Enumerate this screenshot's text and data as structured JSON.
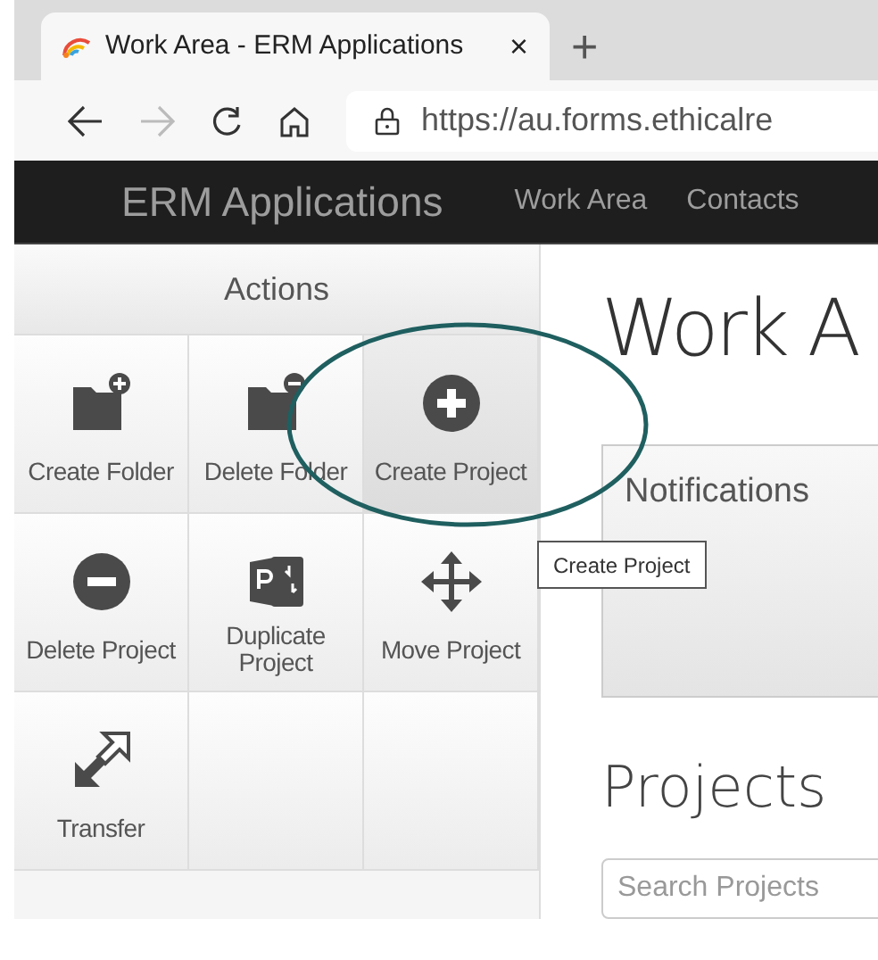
{
  "browser": {
    "tab": {
      "title": "Work Area - ERM Applications",
      "close": "×"
    },
    "new_tab": "+",
    "url": "https://au.forms.ethicalre"
  },
  "app_header": {
    "brand": "ERM Applications",
    "nav": [
      {
        "label": "Work Area",
        "selected": false
      },
      {
        "label": "Contacts",
        "selected": false
      }
    ]
  },
  "actions": {
    "title": "Actions",
    "items": [
      {
        "kind": "create-folder",
        "label": "Create Folder",
        "hovered": false
      },
      {
        "kind": "delete-folder",
        "label": "Delete Folder",
        "hovered": false
      },
      {
        "kind": "create-project",
        "label": "Create Project",
        "hovered": true
      },
      {
        "kind": "delete-project",
        "label": "Delete Project",
        "hovered": false
      },
      {
        "kind": "duplicate-project",
        "label": "Duplicate Project",
        "hovered": false
      },
      {
        "kind": "move-project",
        "label": "Move Project",
        "hovered": false
      },
      {
        "kind": "transfer",
        "label": "Transfer",
        "hovered": false
      }
    ]
  },
  "tooltip": "Create Project",
  "main": {
    "title": "Work A",
    "notifications": {
      "title": "Notifications"
    },
    "projects": {
      "title": "Projects",
      "search": {
        "placeholder": "Search Projects"
      }
    }
  }
}
